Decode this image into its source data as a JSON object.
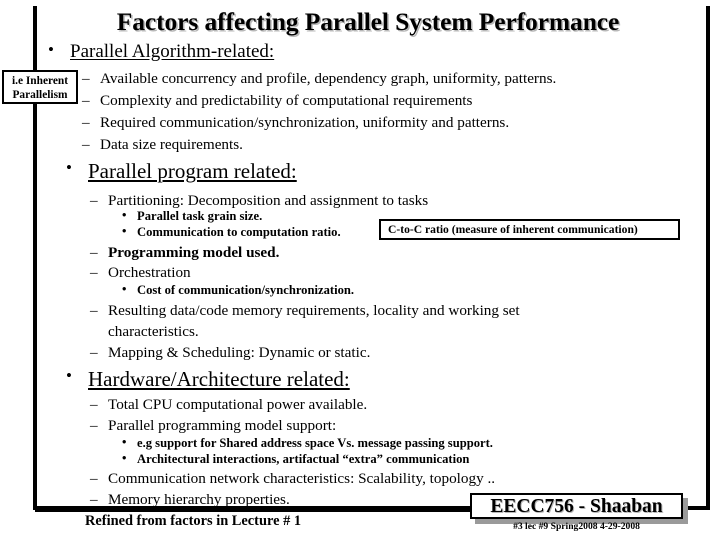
{
  "slide": {
    "title": "Factors affecting Parallel System Performance",
    "footer_note": "Refined from factors in Lecture # 1",
    "badge_title": "EECC756 - Shaaban",
    "badge_meta": "#3  lec #9   Spring2008  4-29-2008"
  },
  "callouts": {
    "inherent_line1": "i.e Inherent",
    "inherent_line2": "Parallelism",
    "ctoc": "C-to-C ratio (measure of inherent communication)"
  },
  "sections": [
    {
      "heading": "Parallel Algorithm-related:",
      "items": [
        "Available concurrency and profile, dependency graph, uniformity, patterns.",
        "Complexity and predictability of computational requirements",
        "Required communication/synchronization, uniformity and patterns.",
        "Data size requirements."
      ]
    },
    {
      "heading": "Parallel program related:",
      "items": [
        "Partitioning: Decomposition and assignment to tasks",
        "Programming model used.",
        "Orchestration",
        "Resulting data/code memory requirements, locality and working set",
        "characteristics.",
        "Mapping & Scheduling: Dynamic or static."
      ],
      "subitems": [
        "Parallel task grain size.",
        "Communication to computation ratio.",
        "Cost of communication/synchronization."
      ]
    },
    {
      "heading": "Hardware/Architecture related:",
      "items": [
        "Total CPU computational power available.",
        "Parallel programming model support:",
        "Communication network characteristics: Scalability, topology ..",
        "Memory hierarchy properties."
      ],
      "subitems": [
        "e.g support for Shared address space Vs. message passing support.",
        "Architectural interactions, artifactual “extra” communication"
      ]
    }
  ],
  "glyphs": {
    "bullet_round": "•",
    "dash": "–"
  }
}
